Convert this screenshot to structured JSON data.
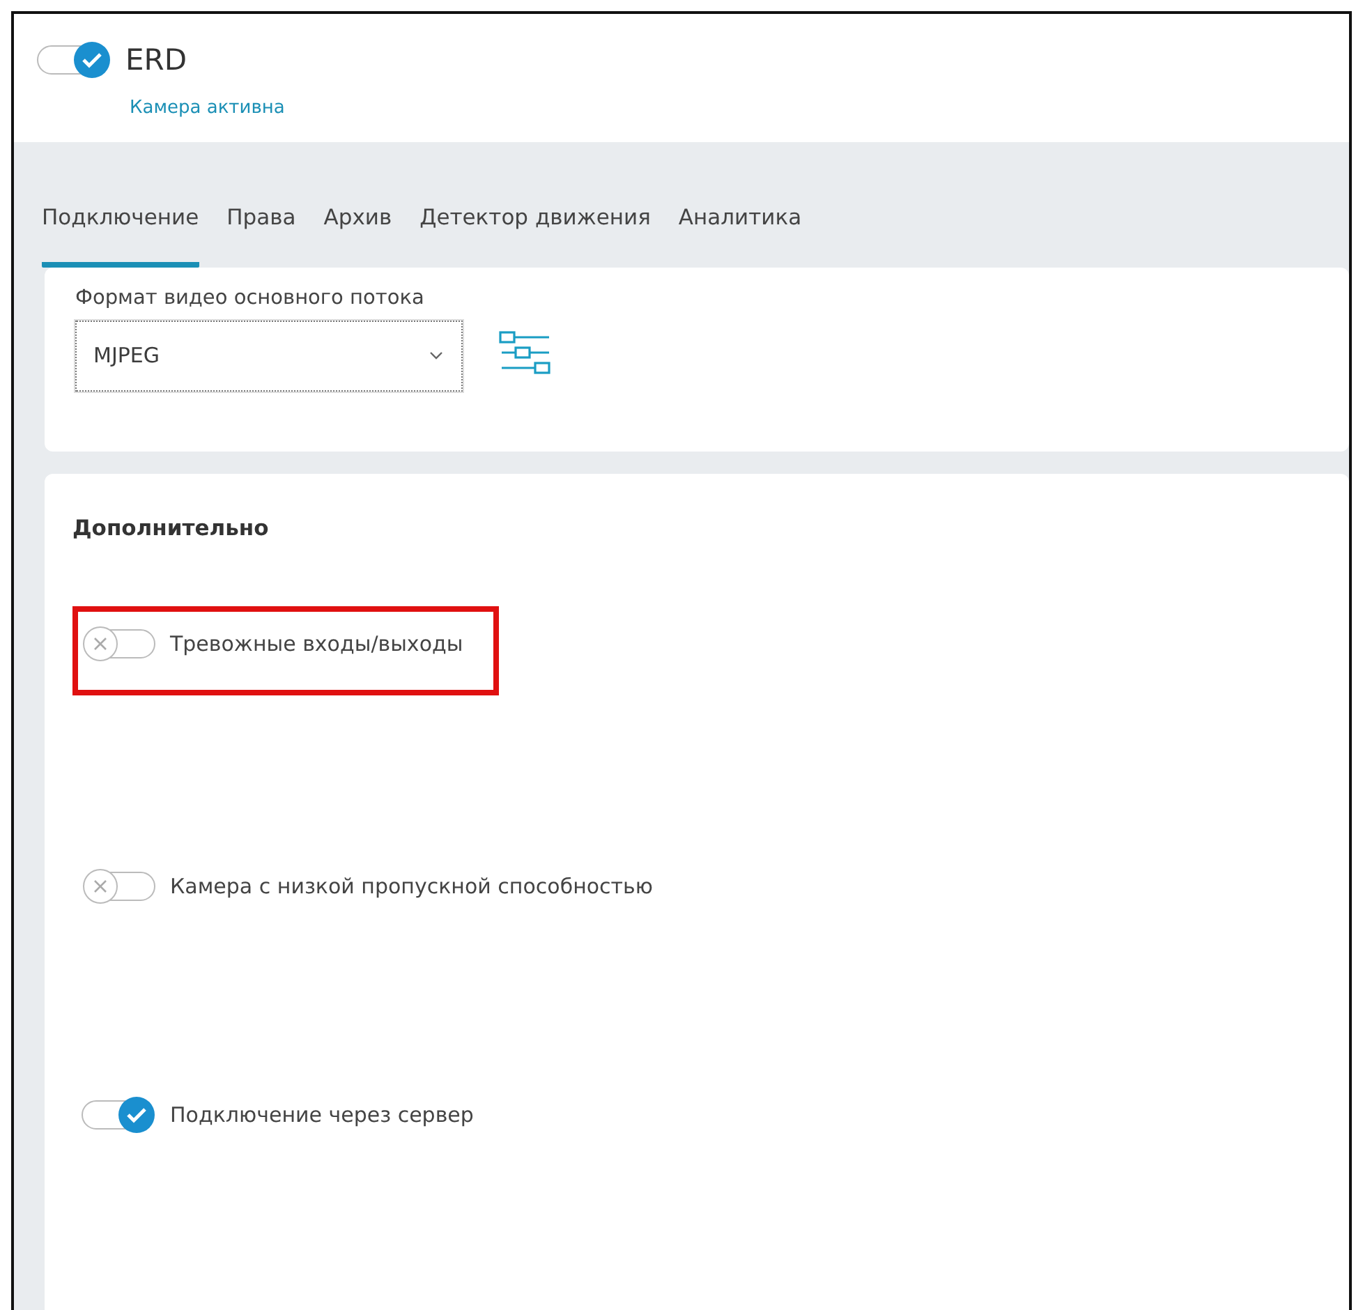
{
  "camera": {
    "enabled": true,
    "name": "ERD",
    "status": "Камера активна"
  },
  "tabs": [
    {
      "label": "Подключение",
      "selected": true
    },
    {
      "label": "Права",
      "selected": false
    },
    {
      "label": "Архив",
      "selected": false
    },
    {
      "label": "Детектор движения",
      "selected": false
    },
    {
      "label": "Аналитика",
      "selected": false
    }
  ],
  "video_format": {
    "label": "Формат видео основного потока",
    "value": "MJPEG"
  },
  "additional": {
    "title": "Дополнительно",
    "options": [
      {
        "label": "Тревожные входы/выходы",
        "on": false,
        "highlighted": true
      },
      {
        "label": "Камера с низкой пропускной способностью",
        "on": false,
        "highlighted": false
      },
      {
        "label": "Подключение через сервер",
        "on": true,
        "highlighted": false
      }
    ]
  }
}
